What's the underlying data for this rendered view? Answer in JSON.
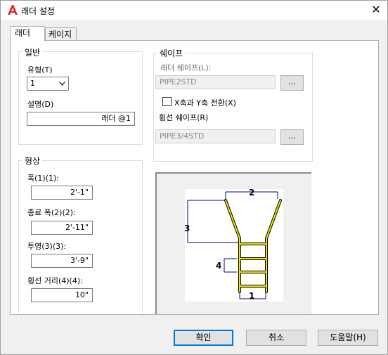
{
  "window": {
    "title": "래더 설정",
    "close_glyph": "✕",
    "icon": "autocad-a-icon",
    "icon_color": "#d9241b"
  },
  "tabs": [
    {
      "label": "래더",
      "active": true
    },
    {
      "label": "케이지",
      "active": false
    }
  ],
  "general": {
    "title": "일반",
    "type_label": "유형(T)",
    "type_value": "1",
    "desc_label": "설명(D)",
    "desc_value": "래더 @1"
  },
  "shape": {
    "title": "쉐이프",
    "ladder_shape_label": "래더 쉐이프(L):",
    "ladder_shape_value": "PIPE2STD",
    "ladder_shape_button": "...",
    "swap_xy_label": "X축과 Y축 전환(X)",
    "swap_xy_checked": false,
    "rung_shape_label": "횡선 쉐이프(R)",
    "rung_shape_value": "PIPE3/4STD",
    "rung_shape_button": "..."
  },
  "geometry": {
    "title": "형상",
    "width_label": "폭(1)(1):",
    "width_value": "2'-1\"",
    "end_width_label": "종료 폭(2)(2):",
    "end_width_value": "2'-11\"",
    "projection_label": "투영(3)(3):",
    "projection_value": "3'-9\"",
    "rung_spacing_label": "횡선 거리(4)(4):",
    "rung_spacing_value": "10\""
  },
  "preview": {
    "labels": [
      "1",
      "2",
      "3",
      "4"
    ],
    "rail_color": "#f2e400"
  },
  "buttons": {
    "ok": "확인",
    "cancel": "취소",
    "help": "도움말(H)"
  },
  "colors": {
    "accent": "#0078d7"
  }
}
